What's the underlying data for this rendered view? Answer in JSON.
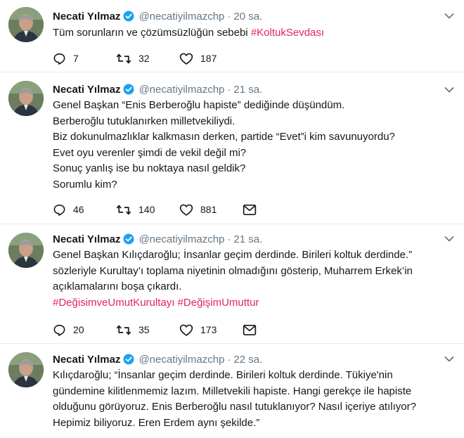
{
  "tweets": [
    {
      "name": "Necati Yılmaz",
      "handle": "@necatiyilmazchp",
      "time": "20 sa.",
      "lines": [
        {
          "text": "Tüm sorunların ve çözümsüzlüğün sebebi ",
          "hashtag": "#KoltukSevdası"
        }
      ],
      "replies": "7",
      "retweets": "32",
      "likes": "187"
    },
    {
      "name": "Necati Yılmaz",
      "handle": "@necatiyilmazchp",
      "time": "21 sa.",
      "lines": [
        {
          "text": "Genel Başkan “Enis Berberoğlu hapiste” dediğinde düşündüm."
        },
        {
          "text": "Berberoğlu tutuklanırken milletvekiliydi."
        },
        {
          "text": "Biz dokunulmazlıklar kalkmasın derken,  partide “Evet”i kim savunuyordu?"
        },
        {
          "text": "Evet oyu verenler şimdi de vekil değil mi?"
        },
        {
          "text": "Sonuç yanlış ise bu noktaya nasıl geldik?"
        },
        {
          "text": "Sorumlu kim?"
        }
      ],
      "replies": "46",
      "retweets": "140",
      "likes": "881"
    },
    {
      "name": "Necati Yılmaz",
      "handle": "@necatiyilmazchp",
      "time": "21 sa.",
      "lines": [
        {
          "text": "Genel Başkan Kılıçdaroğlu; İnsanlar geçim derdinde. Birileri koltuk derdinde.”"
        },
        {
          "text": "sözleriyle Kurultay’ı toplama niyetinin   olmadığını gösterip, Muharrem Erkek’in"
        },
        {
          "text": "açıklamalarını boşa çıkardı."
        },
        {
          "text": "",
          "hashtag": "#DeğisimveUmutKurultayı #DeğişimUmuttur"
        }
      ],
      "replies": "20",
      "retweets": "35",
      "likes": "173"
    },
    {
      "name": "Necati Yılmaz",
      "handle": "@necatiyilmazchp",
      "time": "22 sa.",
      "lines": [
        {
          "text": "Kılıçdaroğlu; “İnsanlar geçim derdinde. Birileri koltuk derdinde. Tükiye'nin"
        },
        {
          "text": "gündemine kilitlenmemiz lazım. Milletvekili hapiste. Hangi gerekçe ile hapiste"
        },
        {
          "text": "olduğunu görüyoruz. Enis Berberoğlu nasıl tutuklanıyor? Nasıl içeriye atılıyor?"
        },
        {
          "text": "Hepimiz biliyoruz. Eren Erdem aynı şekilde.”"
        }
      ]
    }
  ],
  "colors": {
    "hashtag": "#e0245e",
    "verified": "#1da1f2",
    "muted": "#657786",
    "text": "#14171a"
  },
  "icons": [
    "reply-icon",
    "retweet-icon",
    "like-icon",
    "message-icon",
    "verified-badge-icon",
    "chevron-down-icon"
  ]
}
